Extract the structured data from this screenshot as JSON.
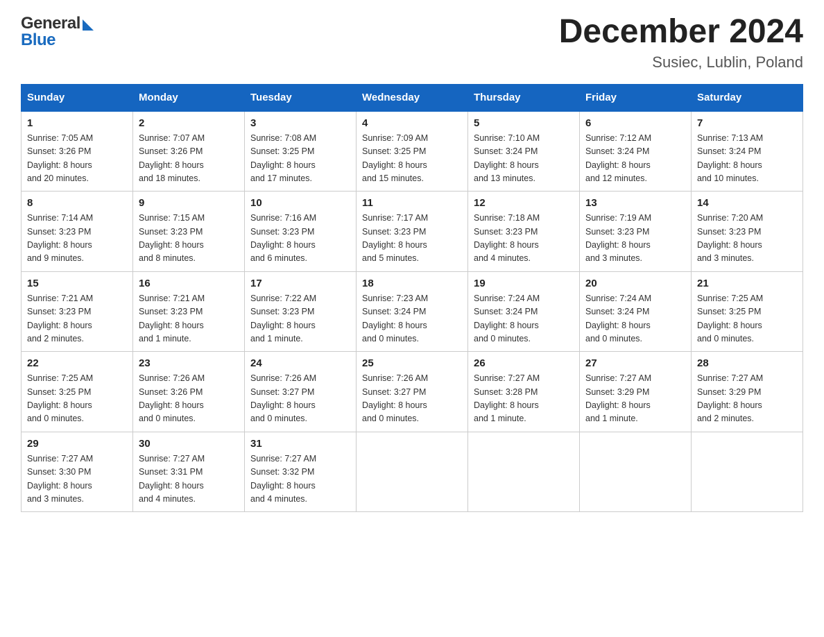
{
  "header": {
    "title": "December 2024",
    "subtitle": "Susiec, Lublin, Poland",
    "logo_general": "General",
    "logo_blue": "Blue"
  },
  "days_of_week": [
    "Sunday",
    "Monday",
    "Tuesday",
    "Wednesday",
    "Thursday",
    "Friday",
    "Saturday"
  ],
  "weeks": [
    [
      {
        "day": "1",
        "sunrise": "7:05 AM",
        "sunset": "3:26 PM",
        "daylight": "8 hours and 20 minutes."
      },
      {
        "day": "2",
        "sunrise": "7:07 AM",
        "sunset": "3:26 PM",
        "daylight": "8 hours and 18 minutes."
      },
      {
        "day": "3",
        "sunrise": "7:08 AM",
        "sunset": "3:25 PM",
        "daylight": "8 hours and 17 minutes."
      },
      {
        "day": "4",
        "sunrise": "7:09 AM",
        "sunset": "3:25 PM",
        "daylight": "8 hours and 15 minutes."
      },
      {
        "day": "5",
        "sunrise": "7:10 AM",
        "sunset": "3:24 PM",
        "daylight": "8 hours and 13 minutes."
      },
      {
        "day": "6",
        "sunrise": "7:12 AM",
        "sunset": "3:24 PM",
        "daylight": "8 hours and 12 minutes."
      },
      {
        "day": "7",
        "sunrise": "7:13 AM",
        "sunset": "3:24 PM",
        "daylight": "8 hours and 10 minutes."
      }
    ],
    [
      {
        "day": "8",
        "sunrise": "7:14 AM",
        "sunset": "3:23 PM",
        "daylight": "8 hours and 9 minutes."
      },
      {
        "day": "9",
        "sunrise": "7:15 AM",
        "sunset": "3:23 PM",
        "daylight": "8 hours and 8 minutes."
      },
      {
        "day": "10",
        "sunrise": "7:16 AM",
        "sunset": "3:23 PM",
        "daylight": "8 hours and 6 minutes."
      },
      {
        "day": "11",
        "sunrise": "7:17 AM",
        "sunset": "3:23 PM",
        "daylight": "8 hours and 5 minutes."
      },
      {
        "day": "12",
        "sunrise": "7:18 AM",
        "sunset": "3:23 PM",
        "daylight": "8 hours and 4 minutes."
      },
      {
        "day": "13",
        "sunrise": "7:19 AM",
        "sunset": "3:23 PM",
        "daylight": "8 hours and 3 minutes."
      },
      {
        "day": "14",
        "sunrise": "7:20 AM",
        "sunset": "3:23 PM",
        "daylight": "8 hours and 3 minutes."
      }
    ],
    [
      {
        "day": "15",
        "sunrise": "7:21 AM",
        "sunset": "3:23 PM",
        "daylight": "8 hours and 2 minutes."
      },
      {
        "day": "16",
        "sunrise": "7:21 AM",
        "sunset": "3:23 PM",
        "daylight": "8 hours and 1 minute."
      },
      {
        "day": "17",
        "sunrise": "7:22 AM",
        "sunset": "3:23 PM",
        "daylight": "8 hours and 1 minute."
      },
      {
        "day": "18",
        "sunrise": "7:23 AM",
        "sunset": "3:24 PM",
        "daylight": "8 hours and 0 minutes."
      },
      {
        "day": "19",
        "sunrise": "7:24 AM",
        "sunset": "3:24 PM",
        "daylight": "8 hours and 0 minutes."
      },
      {
        "day": "20",
        "sunrise": "7:24 AM",
        "sunset": "3:24 PM",
        "daylight": "8 hours and 0 minutes."
      },
      {
        "day": "21",
        "sunrise": "7:25 AM",
        "sunset": "3:25 PM",
        "daylight": "8 hours and 0 minutes."
      }
    ],
    [
      {
        "day": "22",
        "sunrise": "7:25 AM",
        "sunset": "3:25 PM",
        "daylight": "8 hours and 0 minutes."
      },
      {
        "day": "23",
        "sunrise": "7:26 AM",
        "sunset": "3:26 PM",
        "daylight": "8 hours and 0 minutes."
      },
      {
        "day": "24",
        "sunrise": "7:26 AM",
        "sunset": "3:27 PM",
        "daylight": "8 hours and 0 minutes."
      },
      {
        "day": "25",
        "sunrise": "7:26 AM",
        "sunset": "3:27 PM",
        "daylight": "8 hours and 0 minutes."
      },
      {
        "day": "26",
        "sunrise": "7:27 AM",
        "sunset": "3:28 PM",
        "daylight": "8 hours and 1 minute."
      },
      {
        "day": "27",
        "sunrise": "7:27 AM",
        "sunset": "3:29 PM",
        "daylight": "8 hours and 1 minute."
      },
      {
        "day": "28",
        "sunrise": "7:27 AM",
        "sunset": "3:29 PM",
        "daylight": "8 hours and 2 minutes."
      }
    ],
    [
      {
        "day": "29",
        "sunrise": "7:27 AM",
        "sunset": "3:30 PM",
        "daylight": "8 hours and 3 minutes."
      },
      {
        "day": "30",
        "sunrise": "7:27 AM",
        "sunset": "3:31 PM",
        "daylight": "8 hours and 4 minutes."
      },
      {
        "day": "31",
        "sunrise": "7:27 AM",
        "sunset": "3:32 PM",
        "daylight": "8 hours and 4 minutes."
      },
      null,
      null,
      null,
      null
    ]
  ],
  "labels": {
    "sunrise": "Sunrise:",
    "sunset": "Sunset:",
    "daylight": "Daylight:"
  }
}
